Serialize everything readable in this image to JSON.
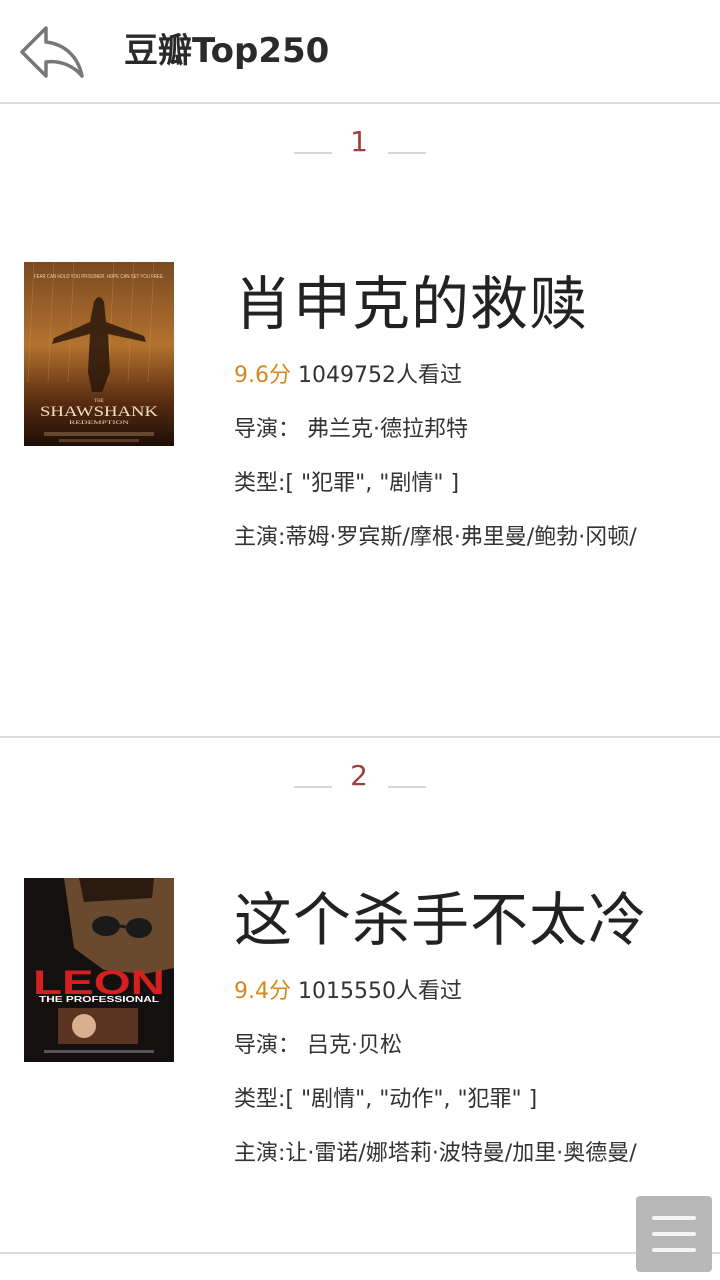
{
  "header": {
    "title": "豆瓣Top250"
  },
  "movies": [
    {
      "rank": "1",
      "title": "肖申克的救赎",
      "score": "9.6分",
      "viewers": "1049752人看过",
      "director": "导演：  弗兰克·德拉邦特",
      "genre": "类型:[ \"犯罪\", \"剧情\" ]",
      "cast": "主演:蒂姆·罗宾斯/摩根·弗里曼/鲍勃·冈顿/",
      "poster": {
        "headline": "FEAR CAN HOLD YOU PRISONER. HOPE CAN SET YOU FREE.",
        "title": "SHAWSHANK",
        "the": "THE",
        "subtitle": "REDEMPTION"
      }
    },
    {
      "rank": "2",
      "title": "这个杀手不太冷",
      "score": "9.4分",
      "viewers": "1015550人看过",
      "director": "导演：  吕克·贝松",
      "genre": "类型:[ \"剧情\", \"动作\", \"犯罪\" ]",
      "cast": "主演:让·雷诺/娜塔莉·波特曼/加里·奥德曼/",
      "poster": {
        "title": "LEON",
        "subtitle": "THE PROFESSIONAL"
      }
    }
  ],
  "colors": {
    "score": "#d4891f",
    "rank": "#a0403a",
    "divider": "#dcdcdc"
  },
  "icons": {
    "back": "back-arrow-icon",
    "menu": "hamburger-menu-icon"
  }
}
